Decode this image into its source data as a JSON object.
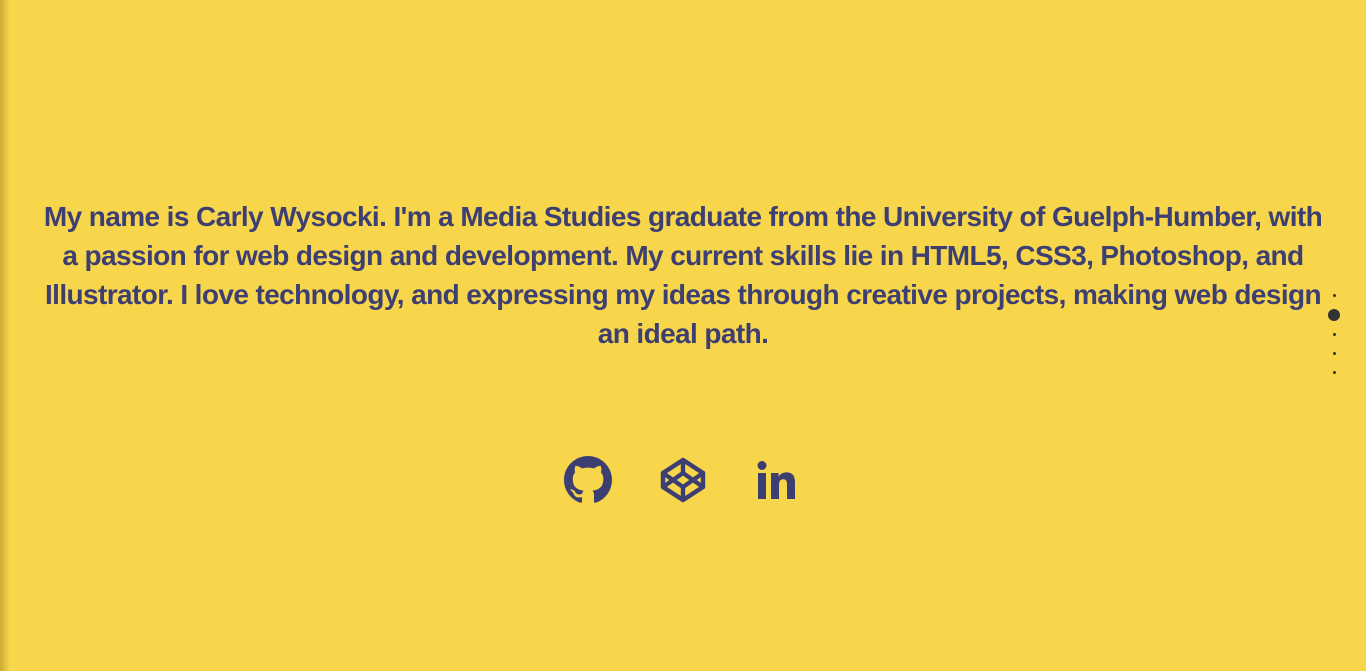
{
  "theme": {
    "background": "#f7d64c",
    "text_color": "#3d3f72",
    "dot_color": "#333333"
  },
  "about": {
    "text": "My name is Carly Wysocki. I'm a Media Studies graduate from the University of Guelph-Humber, with a passion for web design and development. My current skills lie in HTML5, CSS3, Photoshop, and Illustrator. I love technology, and expressing my ideas through creative projects, making web design an ideal path."
  },
  "social_links": [
    {
      "icon": "github-icon"
    },
    {
      "icon": "codepen-icon"
    },
    {
      "icon": "linkedin-icon"
    }
  ],
  "section_nav": {
    "count": 5,
    "active_index": 1
  }
}
